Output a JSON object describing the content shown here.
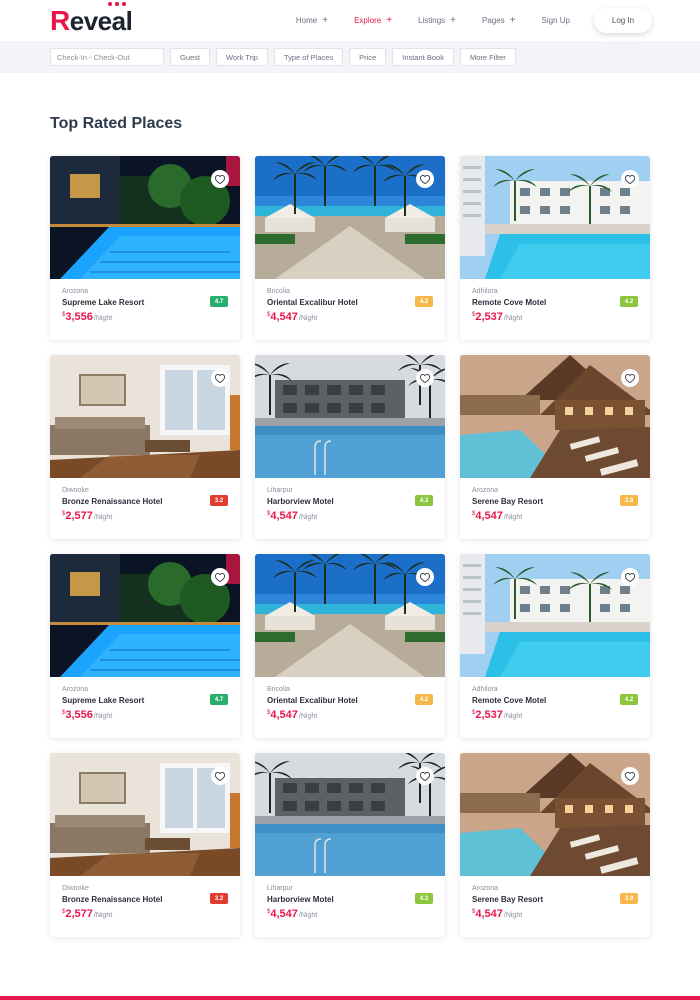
{
  "brand": {
    "name_first": "R",
    "name_rest": "eveal",
    "accent": "#e8174b"
  },
  "nav": {
    "items": [
      {
        "label": "Home",
        "has_plus": true,
        "active": false
      },
      {
        "label": "Explore",
        "has_plus": true,
        "active": true
      },
      {
        "label": "Listings",
        "has_plus": true,
        "active": false
      },
      {
        "label": "Pages",
        "has_plus": true,
        "active": false
      },
      {
        "label": "Sign Up",
        "has_plus": false,
        "active": false
      }
    ],
    "login_label": "Log In"
  },
  "filters": {
    "date_placeholder": "Check-In - Check-Out",
    "buttons": [
      "Guest",
      "Work Trip",
      "Type of Places",
      "Price",
      "Instant Book",
      "More Filter"
    ]
  },
  "section_title": "Top Rated Places",
  "currency": "$",
  "per_label": "/Night",
  "cards": [
    {
      "location": "Arozona",
      "name": "Supreme Lake Resort",
      "price": "3,556",
      "rating": "4.7",
      "rating_color": "#27b06d",
      "image": "pool-night-icon"
    },
    {
      "location": "Bricolia",
      "name": "Oriental Excalibur Hotel",
      "price": "4,547",
      "rating": "4.2",
      "rating_color": "#f7b84b",
      "image": "beach-pool-icon"
    },
    {
      "location": "Adhilora",
      "name": "Remote Cove Motel",
      "price": "2,537",
      "rating": "4.2",
      "rating_color": "#8cc63f",
      "image": "hotel-pool-icon"
    },
    {
      "location": "Diwooke",
      "name": "Bronze Renaissance Hotel",
      "price": "2,577",
      "rating": "3.2",
      "rating_color": "#e23c2f",
      "image": "living-room-icon"
    },
    {
      "location": "Liharpur",
      "name": "Harborview Motel",
      "price": "4,547",
      "rating": "4.3",
      "rating_color": "#8cc63f",
      "image": "palm-pool-icon"
    },
    {
      "location": "Arozona",
      "name": "Serene Bay Resort",
      "price": "4,547",
      "rating": "3.9",
      "rating_color": "#f7b84b",
      "image": "lodge-pool-icon"
    },
    {
      "location": "Arozona",
      "name": "Supreme Lake Resort",
      "price": "3,556",
      "rating": "4.7",
      "rating_color": "#27b06d",
      "image": "pool-night-icon"
    },
    {
      "location": "Bricolia",
      "name": "Oriental Excalibur Hotel",
      "price": "4,547",
      "rating": "4.2",
      "rating_color": "#f7b84b",
      "image": "beach-pool-icon"
    },
    {
      "location": "Adhilora",
      "name": "Remote Cove Motel",
      "price": "2,537",
      "rating": "4.2",
      "rating_color": "#8cc63f",
      "image": "hotel-pool-icon"
    },
    {
      "location": "Diwooke",
      "name": "Bronze Renaissance Hotel",
      "price": "2,577",
      "rating": "3.2",
      "rating_color": "#e23c2f",
      "image": "living-room-icon"
    },
    {
      "location": "Liharpur",
      "name": "Harborview Motel",
      "price": "4,547",
      "rating": "4.3",
      "rating_color": "#8cc63f",
      "image": "palm-pool-icon"
    },
    {
      "location": "Arozona",
      "name": "Serene Bay Resort",
      "price": "4,547",
      "rating": "3.9",
      "rating_color": "#f7b84b",
      "image": "lodge-pool-icon"
    }
  ]
}
